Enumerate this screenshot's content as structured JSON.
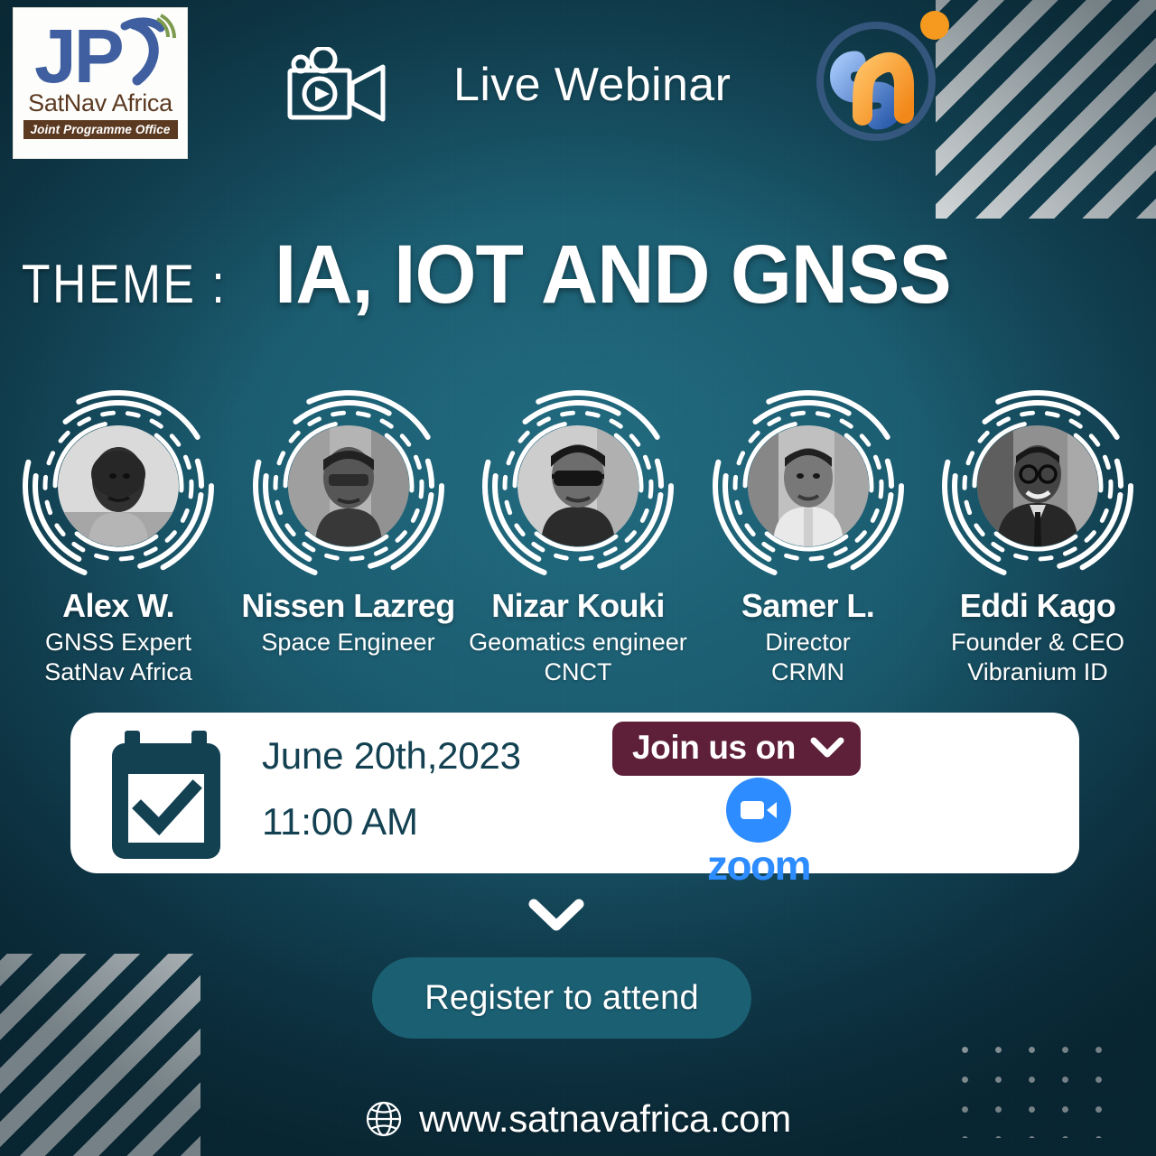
{
  "brand": {
    "logo_initials": "JP",
    "logo_name": "SatNav Africa",
    "logo_tagline": "Joint Programme Office",
    "mark_name": "satnav-monogram"
  },
  "header": {
    "camera_icon": "video-camera-icon",
    "live_label": "Live Webinar"
  },
  "theme": {
    "label": "THEME :",
    "value": "IA, IOT AND GNSS"
  },
  "speakers": [
    {
      "name": "Alex W.",
      "role_line1": "GNSS Expert",
      "role_line2": "SatNav Africa"
    },
    {
      "name": "Nissen Lazreg",
      "role_line1": "Space Engineer",
      "role_line2": ""
    },
    {
      "name": "Nizar Kouki",
      "role_line1": "Geomatics engineer",
      "role_line2": "CNCT"
    },
    {
      "name": "Samer L.",
      "role_line1": "Director",
      "role_line2": "CRMN"
    },
    {
      "name": "Eddi Kago",
      "role_line1": "Founder & CEO",
      "role_line2": "Vibranium ID"
    }
  ],
  "event": {
    "calendar_icon": "calendar-check-icon",
    "date": "June 20th,2023",
    "time": "11:00 AM",
    "join_label": "Join us on",
    "join_chevron_icon": "chevron-down-icon",
    "platform": "zoom",
    "platform_icon": "zoom-camera-icon"
  },
  "cta": {
    "scroll_chevron_icon": "chevron-down-icon",
    "register_label": "Register to attend"
  },
  "footer": {
    "globe_icon": "globe-icon",
    "url": "www.satnavafrica.com"
  },
  "colors": {
    "bg_center": "#226b80",
    "bg_edge": "#0e3243",
    "card_bg": "#ffffff",
    "card_text": "#134152",
    "join_badge": "#5e1f38",
    "zoom_blue": "#2d8cff",
    "register_btn": "#1b5f73",
    "logo_blue": "#3f5fa0",
    "logo_brown": "#5c3a22",
    "accent_orange": "#f59a1e"
  }
}
